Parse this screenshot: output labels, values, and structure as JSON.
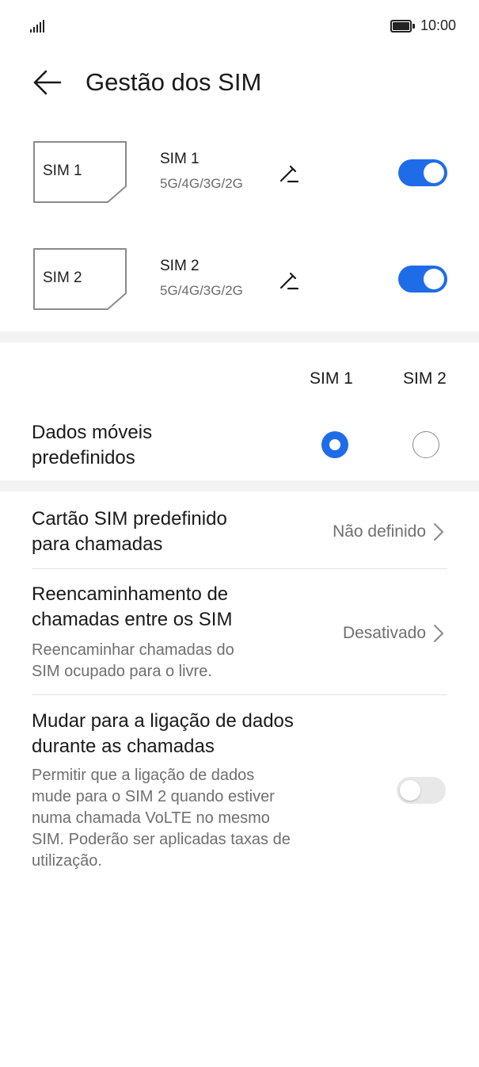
{
  "status_bar": {
    "time": "10:00",
    "signal_icon": "signal-icon",
    "battery_icon": "battery-icon"
  },
  "header": {
    "back_icon": "arrow-left-icon",
    "title": "Gestão dos SIM"
  },
  "sims": [
    {
      "card_label": "SIM 1",
      "name": "SIM 1",
      "network": "5G/4G/3G/2G",
      "enabled": true,
      "edit_icon": "pencil-icon"
    },
    {
      "card_label": "SIM 2",
      "name": "SIM 2",
      "network": "5G/4G/3G/2G",
      "enabled": true,
      "edit_icon": "pencil-icon"
    }
  ],
  "columns": [
    "SIM 1",
    "SIM 2"
  ],
  "default_data": {
    "label_line1": "Dados móveis",
    "label_line2": "predefinidos",
    "selected": "SIM 1"
  },
  "settings": {
    "default_call": {
      "label_line1": "Cartão SIM predefinido",
      "label_line2": "para chamadas",
      "value": "Não definido"
    },
    "call_forwarding": {
      "label_line1": "Reencaminhamento de",
      "label_line2": "chamadas entre os SIM",
      "desc_line1": "Reencaminhar chamadas do",
      "desc_line2": "SIM ocupado para o livre.",
      "value": "Desativado"
    },
    "data_switch": {
      "label_line1": "Mudar para a ligação de dados",
      "label_line2": "durante as chamadas",
      "desc_line1": "Permitir que a ligação de dados",
      "desc_line2": "mude para o SIM 2 quando estiver",
      "desc_line3": "numa chamada VoLTE no mesmo",
      "desc_line4": "SIM. Poderão ser aplicadas taxas de",
      "desc_line5": "utilização.",
      "enabled": false
    }
  },
  "colors": {
    "accent": "#1f6ce9",
    "secondary_text": "#6f6f6f",
    "band": "#f3f3f3"
  }
}
